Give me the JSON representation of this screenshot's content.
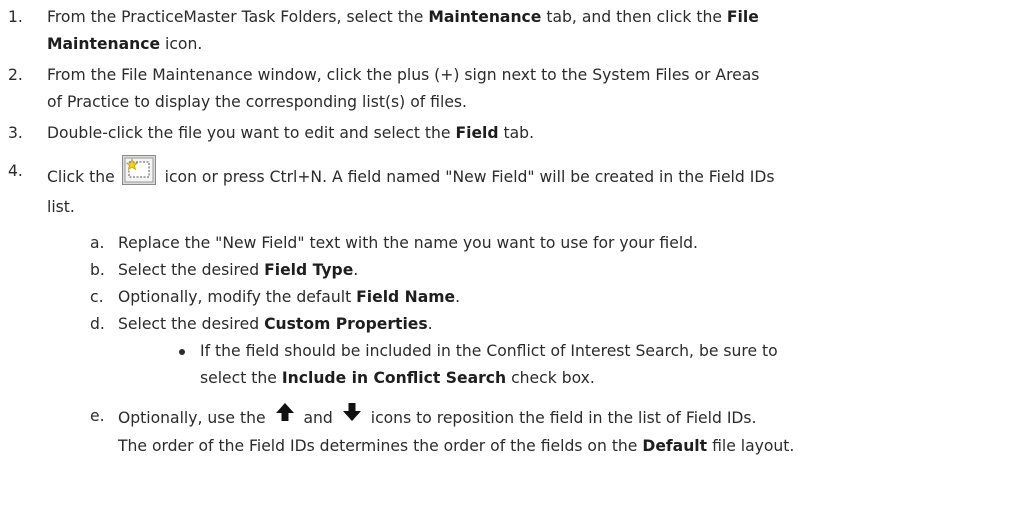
{
  "steps": {
    "s1": {
      "num": "1.",
      "pre": "From the PracticeMaster Task Folders, select the ",
      "b1": "Maintenance",
      "mid": " tab, and then click the ",
      "b2a": "File",
      "b2b": "Maintenance",
      "post": " icon."
    },
    "s2": {
      "num": "2.",
      "l1": "From the File Maintenance window, click the plus (+) sign next to the System Files or Areas",
      "l2": "of Practice to display the corresponding list(s) of files."
    },
    "s3": {
      "num": "3.",
      "pre": "Double-click the file you want to edit and select the ",
      "b": "Field",
      "post": " tab."
    },
    "s4": {
      "num": "4.",
      "pre": "Click the ",
      "icon": "new-field-icon",
      "post": " icon or press Ctrl+N. A field named \"New Field\" will be created in the Field IDs",
      "l2": "list."
    }
  },
  "substeps": {
    "a": {
      "letter": "a.",
      "text": "Replace the \"New Field\" text with the name you want to use for your field."
    },
    "b": {
      "letter": "b.",
      "pre": "Select the desired ",
      "b": "Field Type",
      "post": "."
    },
    "c": {
      "letter": "c.",
      "pre": "Optionally, modify the default ",
      "b": "Field Name",
      "post": "."
    },
    "d": {
      "letter": "d.",
      "pre": "Select the desired ",
      "b": "Custom Properties",
      "post": "."
    },
    "bullet": {
      "l1": "If the field should be included in the Conflict of Interest Search, be sure to",
      "l2pre": "select the ",
      "l2b": "Include in Conflict Search",
      "l2post": " check box."
    },
    "e": {
      "letter": "e.",
      "pre": "Optionally, use the ",
      "up_icon": "arrow-up-icon",
      "and": " and ",
      "down_icon": "arrow-down-icon",
      "post": " icons to reposition the field in the list of Field IDs.",
      "l2pre": "The order of the Field IDs determines the order of the fields on the ",
      "l2b": "Default",
      "l2post": " file layout."
    }
  }
}
